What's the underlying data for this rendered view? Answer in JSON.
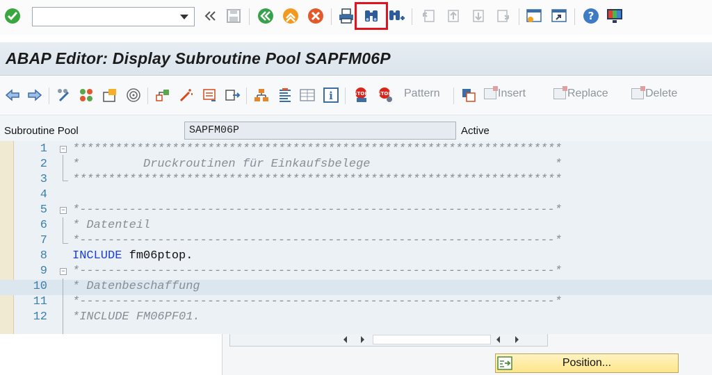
{
  "window": {
    "title": "ABAP Editor: Display Subroutine Pool SAPFM06P"
  },
  "command_field": {
    "value": "",
    "placeholder": ""
  },
  "toolbar1": {
    "icons": [
      "check-icon",
      "command-field",
      "double-chevron-left-icon",
      "save-icon",
      "back-icon",
      "exit-icon",
      "cancel-icon",
      "print-icon",
      "find-icon",
      "find-next-icon",
      "first-page-icon",
      "previous-page-icon",
      "next-page-icon",
      "last-page-icon",
      "new-session-icon",
      "shortcut-icon",
      "help-icon",
      "customize-layout-icon"
    ],
    "highlighted": "find-icon"
  },
  "toolbar2": {
    "pattern_label": "Pattern",
    "insert_label": "Insert",
    "replace_label": "Replace",
    "delete_label": "Delete"
  },
  "header": {
    "program_type_label": "Subroutine Pool",
    "program_name": "SAPFM06P",
    "status": "Active"
  },
  "editor": {
    "lines": [
      {
        "num": "1",
        "text": "*********************************************************************",
        "type": "comment"
      },
      {
        "num": "2",
        "text": "*         Druckroutinen für Einkaufsbelege                          *",
        "type": "comment"
      },
      {
        "num": "3",
        "text": "*********************************************************************",
        "type": "comment"
      },
      {
        "num": "4",
        "text": "",
        "type": "plain"
      },
      {
        "num": "5",
        "text": "*-------------------------------------------------------------------*",
        "type": "comment"
      },
      {
        "num": "6",
        "text": "* Datenteil",
        "type": "comment"
      },
      {
        "num": "7",
        "text": "*-------------------------------------------------------------------*",
        "type": "comment"
      },
      {
        "num": "8",
        "keyword": "INCLUDE",
        "text": " fm06ptop.",
        "type": "code"
      },
      {
        "num": "9",
        "text": "*-------------------------------------------------------------------*",
        "type": "comment"
      },
      {
        "num": "10",
        "text": "* Datenbeschaffung",
        "type": "comment"
      },
      {
        "num": "11",
        "text": "*-------------------------------------------------------------------*",
        "type": "comment"
      },
      {
        "num": "12",
        "text": "*INCLUDE FM06PF01.",
        "type": "comment"
      }
    ],
    "highlighted_line": "10"
  },
  "bottom": {
    "position_label": "Position..."
  },
  "colors": {
    "highlight_box": "#e0141e",
    "keyword": "#1a3fd4",
    "comment": "#868e95",
    "line_number": "#3c7fa8"
  }
}
